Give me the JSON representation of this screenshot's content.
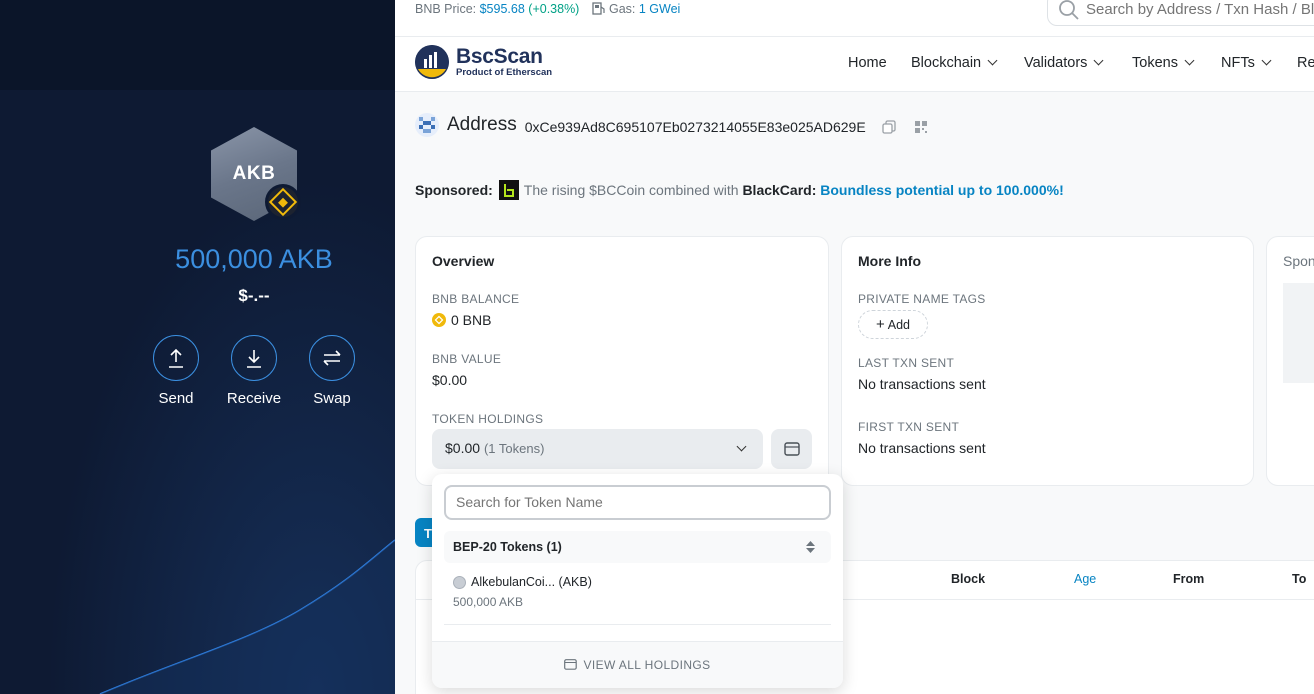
{
  "wallet": {
    "token_symbol": "AKB",
    "amount": "500,000 AKB",
    "usd_value": "$-.--",
    "actions": [
      {
        "label": "Send",
        "icon": "send-up-arrow-icon"
      },
      {
        "label": "Receive",
        "icon": "receive-down-arrow-icon"
      },
      {
        "label": "Swap",
        "icon": "swap-arrows-icon"
      }
    ],
    "colors": {
      "bg": "#0e1a33",
      "accent": "#3b8fe0"
    }
  },
  "topbar": {
    "price_label": "BNB Price: ",
    "price_value": "$595.68",
    "price_change": "(+0.38%)",
    "gas_label": "Gas: ",
    "gas_value": "1 GWei",
    "search_placeholder": "Search by Address / Txn Hash / Bl"
  },
  "nav": {
    "brand": "BscScan",
    "tagline": "Product of Etherscan",
    "links": [
      "Home",
      "Blockchain",
      "Validators",
      "Tokens",
      "NFTs",
      "Re"
    ]
  },
  "address": {
    "title": "Address",
    "hash": "0xCe939Ad8C695107Eb0273214055E83e025AD629E"
  },
  "sponsored": {
    "label": "Sponsored:",
    "text": "The rising $BCCoin combined with",
    "brand": "BlackCard:",
    "highlight": "Boundless potential up to 100.000%!"
  },
  "overview": {
    "title": "Overview",
    "bnb_balance_label": "BNB BALANCE",
    "bnb_balance_value": "0 BNB",
    "bnb_value_label": "BNB VALUE",
    "bnb_value_value": "$0.00",
    "token_holdings_label": "TOKEN HOLDINGS",
    "token_holdings_value": "$0.00",
    "token_holdings_count": "(1 Tokens)"
  },
  "more_info": {
    "title": "More Info",
    "private_tags_label": "PRIVATE NAME TAGS",
    "add_label": "Add",
    "last_txn_label": "LAST TXN SENT",
    "last_txn_value": "No transactions sent",
    "first_txn_label": "FIRST TXN SENT",
    "first_txn_value": "No transactions sent"
  },
  "third_card": {
    "title": "Spon"
  },
  "dropdown": {
    "search_placeholder": "Search for Token Name",
    "category": "BEP-20 Tokens (1)",
    "items": [
      {
        "name": "AlkebulanCoi... (AKB)",
        "amount": "500,000 AKB"
      }
    ],
    "view_all": "VIEW ALL HOLDINGS"
  },
  "tab_fragment": "T",
  "table": {
    "headers": [
      "Block",
      "Age",
      "From",
      "To"
    ]
  }
}
